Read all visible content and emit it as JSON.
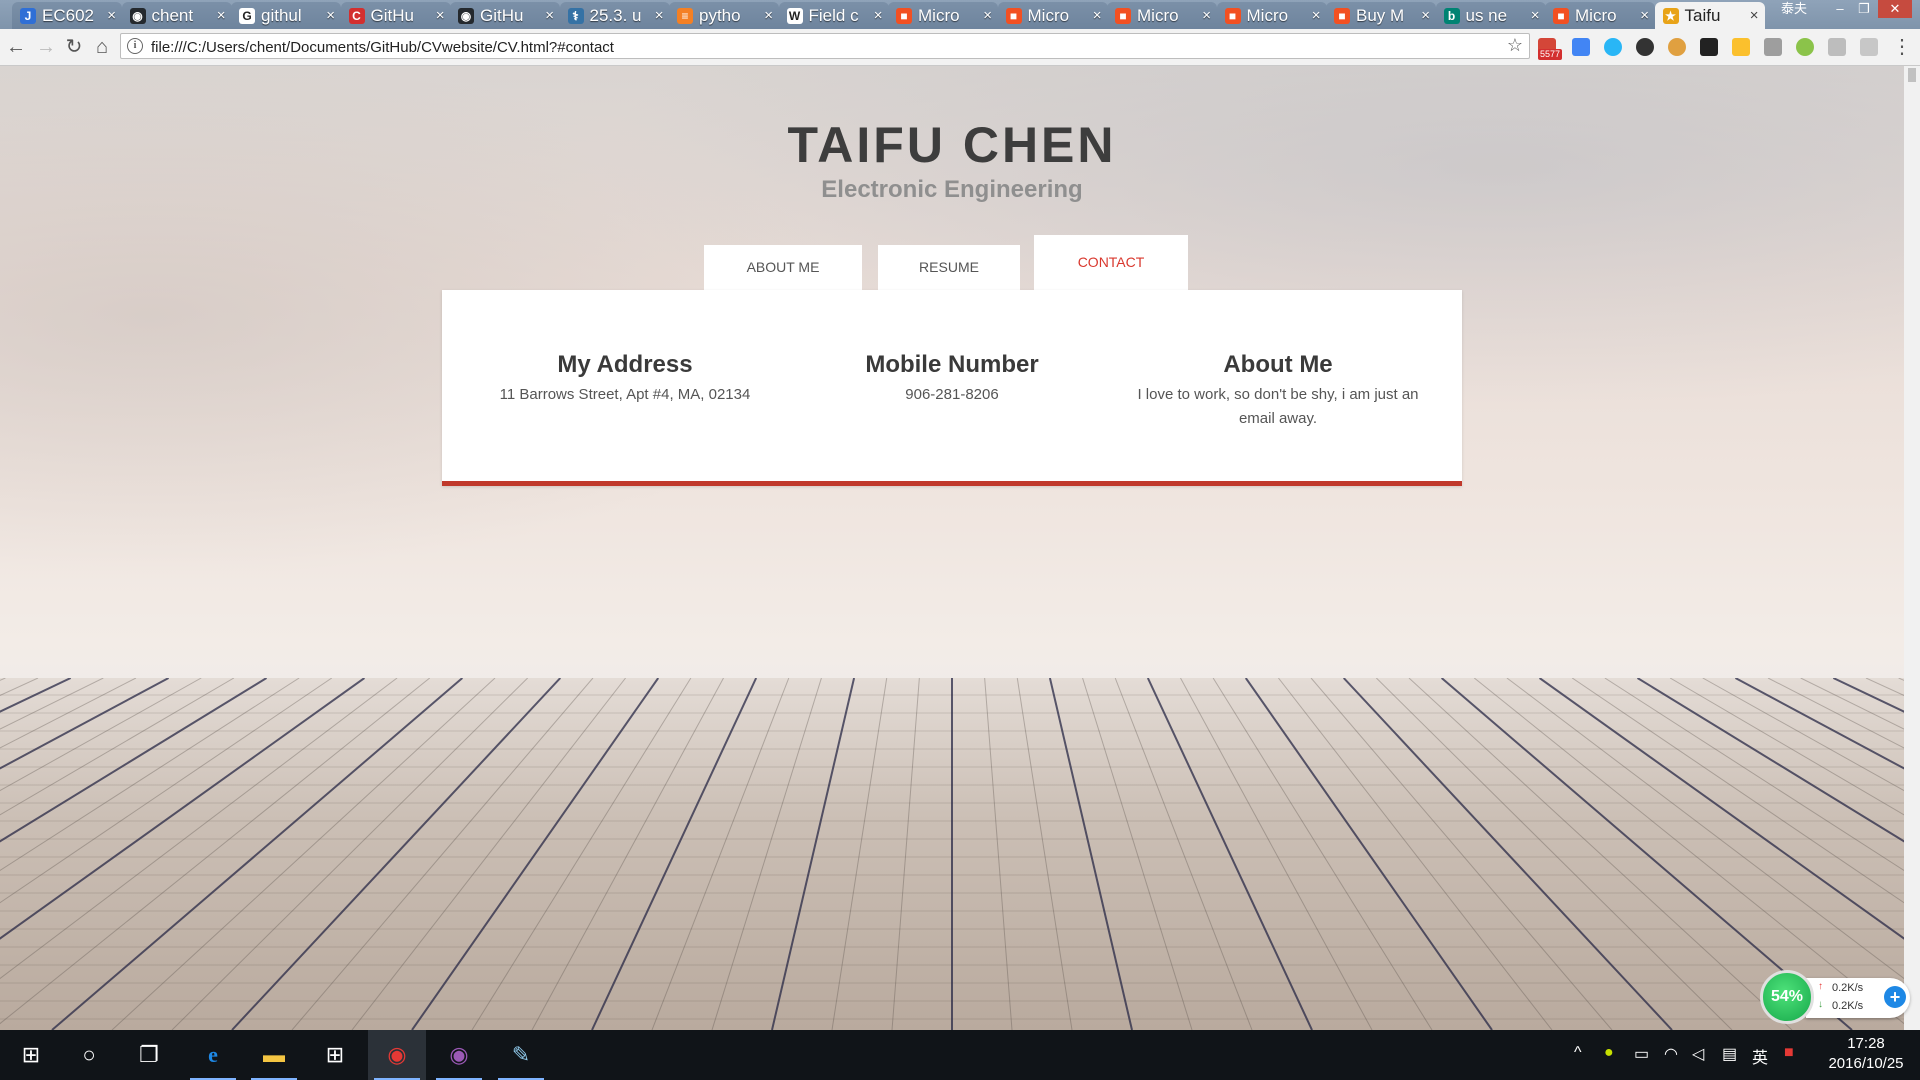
{
  "browser": {
    "tabs": [
      {
        "label": "EC602",
        "favicon": "jira-icon",
        "color": "#2f6fd6",
        "glyph": "J"
      },
      {
        "label": "chent",
        "favicon": "github-icon",
        "color": "#24292e",
        "glyph": "◉"
      },
      {
        "label": "githul",
        "favicon": "google-icon",
        "color": "#ffffff",
        "glyph": "G"
      },
      {
        "label": "GitHu",
        "favicon": "c-icon",
        "color": "#d32f2f",
        "glyph": "C"
      },
      {
        "label": "GitHu",
        "favicon": "github-icon",
        "color": "#24292e",
        "glyph": "◉"
      },
      {
        "label": "25.3. u",
        "favicon": "python-icon",
        "color": "#3572a5",
        "glyph": "⚕"
      },
      {
        "label": "pytho",
        "favicon": "stackoverflow-icon",
        "color": "#f48024",
        "glyph": "≡"
      },
      {
        "label": "Field c",
        "favicon": "wikipedia-icon",
        "color": "#ffffff",
        "glyph": "W"
      },
      {
        "label": "Micro",
        "favicon": "microsoft-icon",
        "color": "#f25022",
        "glyph": "■"
      },
      {
        "label": "Micro",
        "favicon": "microsoft-icon",
        "color": "#f25022",
        "glyph": "■"
      },
      {
        "label": "Micro",
        "favicon": "microsoft-icon",
        "color": "#f25022",
        "glyph": "■"
      },
      {
        "label": "Micro",
        "favicon": "microsoft-icon",
        "color": "#f25022",
        "glyph": "■"
      },
      {
        "label": "Buy M",
        "favicon": "microsoft-icon",
        "color": "#f25022",
        "glyph": "■"
      },
      {
        "label": "us ne",
        "favicon": "bing-icon",
        "color": "#008373",
        "glyph": "b"
      },
      {
        "label": "Micro",
        "favicon": "microsoft-icon",
        "color": "#f25022",
        "glyph": "■"
      },
      {
        "label": "Taifu",
        "favicon": "star-icon",
        "color": "#e8a317",
        "glyph": "★",
        "active": true
      }
    ],
    "window_user": "泰夫",
    "address": "file:///C:/Users/chent/Documents/GitHub/CVwebsite/CV.html?#contact",
    "mail_badge": "5577"
  },
  "page": {
    "name": "TAIFU CHEN",
    "subtitle": "Electronic Engineering",
    "tabs": {
      "about": "ABOUT ME",
      "resume": "RESUME",
      "contact": "CONTACT"
    },
    "active_tab": "contact",
    "contact": {
      "address_title": "My Address",
      "address_text": "11 Barrows Street, Apt #4, MA, 02134",
      "mobile_title": "Mobile Number",
      "mobile_text": "906-281-8206",
      "about_title": "About Me",
      "about_text": "I love to work, so don't be shy, i am just an email away."
    },
    "accent_color": "#c0392b"
  },
  "net_widget": {
    "percent": "54%",
    "up": "0.2K/s",
    "down": "0.2K/s"
  },
  "taskbar": {
    "ime": "英",
    "time": "17:28",
    "date": "2016/10/25"
  }
}
